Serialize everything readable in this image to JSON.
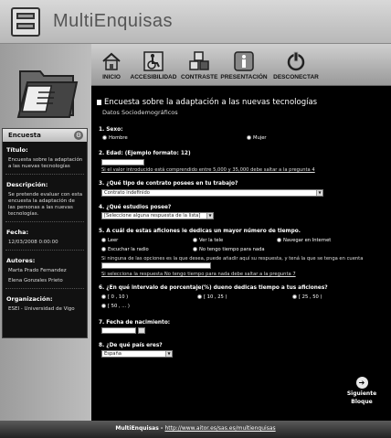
{
  "app": {
    "title": "MultiEnquisas"
  },
  "toolbar": {
    "items": [
      {
        "label": "INICIO",
        "icon": "home-icon"
      },
      {
        "label": "ACCESIBILIDAD",
        "icon": "wheelchair-icon"
      },
      {
        "label": "CONTRASTE",
        "icon": "contrast-icon"
      },
      {
        "label": "PRESENTACIÓN",
        "icon": "info-icon"
      },
      {
        "label": "DESCONECTAR",
        "icon": "power-icon"
      }
    ]
  },
  "sidebar": {
    "header": "Encuesta",
    "titulo_label": "Título:",
    "titulo_value": "Encuesta sobre la adaptación a las nuevas tecnologías",
    "descripcion_label": "Descripción:",
    "descripcion_value": "Se pretende evaluar con esta encuesta la adaptación de las personas a las nuevas tecnologías.",
    "fecha_label": "Fecha:",
    "fecha_value": "12/03/2008 0:00:00",
    "autores_label": "Autores:",
    "autor1": "Marta Prado Fernandez",
    "autor2": "Elena Gonzales Prieto",
    "org_label": "Organización:",
    "org_value": "ESEI - Universidad de Vigo"
  },
  "survey": {
    "title": "Encuesta sobre la adaptación a las nuevas tecnologías",
    "subtitle": "Datos Sociodemográficos",
    "q1": {
      "label": "1. Sexo:",
      "opt1": "Hombre",
      "opt2": "Mujer"
    },
    "q2": {
      "label": "2. Edad: (Ejemplo formato: 12)",
      "note": "Si el valor introducido está comprendido entre 5,000 y 35,000 debe saltar a la pregunta 4"
    },
    "q3": {
      "label": "3. ¿Qué tipo de contrato posees en tu trabajo?",
      "selected": "Contrato indefinido"
    },
    "q4": {
      "label": "4. ¿Qué estudios posee?",
      "selected": "[Seleccione alguna respuesta de la lista]"
    },
    "q5": {
      "label": "5. A cuál de estas aficiones le dedicas un mayor número de tiempo.",
      "o1": "Leer",
      "o2": "Ver la tele",
      "o3": "Navegar en Internet",
      "o4": "Escuchar la radio",
      "o5": "No tengo tiempo para nada",
      "note1": "Si ninguna de las opciones es la que desea, puede añadir aquí su respuesta, y tená la que se tenga en cuenta",
      "note2": "Si selecciona la respuesta No tengo tiempo para nada debe saltar a la pregunta 7"
    },
    "q6": {
      "label": "6. ¿En qué intervalo de porcentaje(%) dueno dedicas tiempo a tus aficiones?",
      "o1": "[ 0 , 10 )",
      "o2": "[ 10 , 25 )",
      "o3": "[ 25 , 50 )",
      "o4": "[ 50 , ... )"
    },
    "q7": {
      "label": "7. Fecha de nacimiento:"
    },
    "q8": {
      "label": "8. ¿De qué país eres?",
      "selected": "España"
    },
    "next_line1": "Siguiente",
    "next_line2": "Bloque"
  },
  "footer": {
    "prefix": "MultiEnquisas - ",
    "url": "http://www.aitor.es/sas.es/multienquisas"
  }
}
